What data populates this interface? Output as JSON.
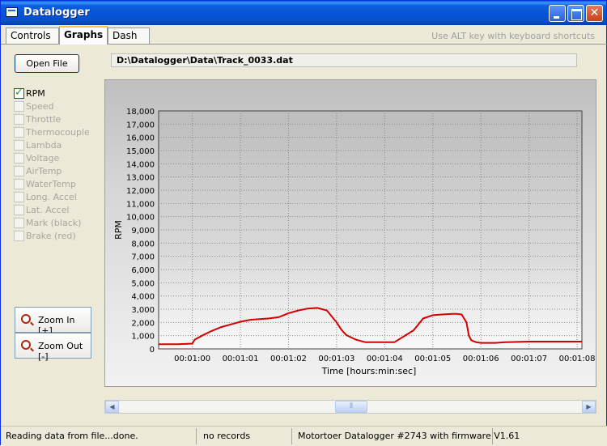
{
  "window": {
    "title": "Datalogger"
  },
  "tabs": [
    {
      "label": "Controls",
      "active": false
    },
    {
      "label": "Graphs",
      "active": true
    },
    {
      "label": "Dash",
      "active": false
    }
  ],
  "shortcut_hint": "Use ALT key with keyboard shortcuts",
  "toolbar": {
    "open_file_label": "Open File",
    "file_path": "D:\\Datalogger\\Data\\Track_0033.dat"
  },
  "channels": [
    {
      "label": "RPM",
      "checked": true,
      "enabled": true
    },
    {
      "label": "Speed",
      "checked": false,
      "enabled": false
    },
    {
      "label": "Throttle",
      "checked": false,
      "enabled": false
    },
    {
      "label": "Thermocouple",
      "checked": false,
      "enabled": false
    },
    {
      "label": "Lambda",
      "checked": false,
      "enabled": false
    },
    {
      "label": "Voltage",
      "checked": false,
      "enabled": false
    },
    {
      "label": "AirTemp",
      "checked": false,
      "enabled": false
    },
    {
      "label": "WaterTemp",
      "checked": false,
      "enabled": false
    },
    {
      "label": "Long. Accel",
      "checked": false,
      "enabled": false
    },
    {
      "label": "Lat. Accel",
      "checked": false,
      "enabled": false
    },
    {
      "label": "Mark (black)",
      "checked": false,
      "enabled": false
    },
    {
      "label": "Brake (red)",
      "checked": false,
      "enabled": false
    }
  ],
  "zoom": {
    "in_label": "Zoom In [+]",
    "out_label": "Zoom Out [-]"
  },
  "chart_data": {
    "type": "line",
    "xlabel": "Time [hours:min:sec]",
    "ylabel": "RPM",
    "ylim": [
      0,
      18000
    ],
    "y_ticks": [
      "0",
      "1,000",
      "2,000",
      "3,000",
      "4,000",
      "5,000",
      "6,000",
      "7,000",
      "8,000",
      "9,000",
      "10,000",
      "11,000",
      "12,000",
      "13,000",
      "14,000",
      "15,000",
      "16,000",
      "17,000",
      "18,000"
    ],
    "x_tick_labels": [
      "00:01:00",
      "00:01:01",
      "00:01:02",
      "00:01:03",
      "00:01:04",
      "00:01:05",
      "00:01:06",
      "00:01:07",
      "00:01:08"
    ],
    "xlim": [
      59.3,
      68.1
    ],
    "grid": true,
    "line_color": "#d40000",
    "series": [
      {
        "x": [
          59.3,
          59.7,
          60.0,
          60.05,
          60.2,
          60.4,
          60.6,
          60.8,
          61.0,
          61.2,
          61.4,
          61.6,
          61.8,
          62.0,
          62.2,
          62.4,
          62.6,
          62.8,
          63.0,
          63.1,
          63.2,
          63.4,
          63.6,
          63.7,
          64.0,
          64.2,
          64.4,
          64.6,
          64.8,
          65.0,
          65.2,
          65.4,
          65.5,
          65.6,
          65.7,
          65.75,
          65.8,
          65.9,
          66.0,
          66.3,
          66.5,
          67.0,
          67.5,
          68.1
        ],
        "y": [
          350,
          350,
          400,
          700,
          1000,
          1350,
          1650,
          1850,
          2050,
          2200,
          2250,
          2300,
          2400,
          2700,
          2900,
          3050,
          3100,
          2900,
          2000,
          1450,
          1050,
          700,
          500,
          500,
          500,
          500,
          950,
          1400,
          2300,
          2550,
          2600,
          2650,
          2650,
          2600,
          2000,
          1000,
          650,
          500,
          450,
          450,
          500,
          550,
          550,
          550
        ]
      }
    ]
  },
  "status": {
    "message": "Reading data from file...done.",
    "records": "no records",
    "device": "Motortoer Datalogger #2743 with firmware V1.61"
  }
}
